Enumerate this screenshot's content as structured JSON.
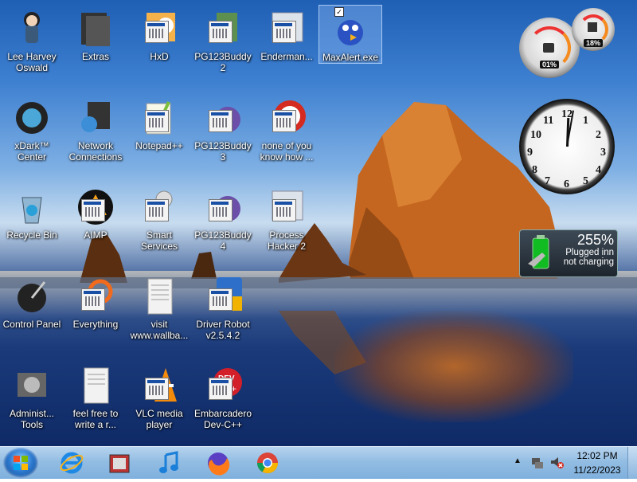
{
  "desktop": {
    "icons": [
      {
        "label": "Lee Harvey Oswald"
      },
      {
        "label": "Extras"
      },
      {
        "label": "HxD"
      },
      {
        "label": "PG123Buddy2"
      },
      {
        "label": "Enderman..."
      },
      {
        "label": "MaxAlert.exe"
      },
      {
        "label": "xDark™ Center"
      },
      {
        "label": "Network Connections"
      },
      {
        "label": "Notepad++"
      },
      {
        "label": "PG123Buddy3"
      },
      {
        "label": "none of you know how ..."
      },
      {
        "label": "Recycle Bin"
      },
      {
        "label": "AIMP"
      },
      {
        "label": "Smart Services"
      },
      {
        "label": "PG123Buddy4"
      },
      {
        "label": "Process Hacker 2"
      },
      {
        "label": "Control Panel"
      },
      {
        "label": "Everything"
      },
      {
        "label": "visit www.wallba..."
      },
      {
        "label": "Driver Robot v2.5.4.2"
      },
      {
        "label": "Administ... Tools"
      },
      {
        "label": "feel free to write a r..."
      },
      {
        "label": "VLC media player"
      },
      {
        "label": "Embarcadero Dev-C++"
      }
    ]
  },
  "gadgets": {
    "cpu_meter": {
      "cpu_percent": "01%",
      "memory_percent": "18%"
    },
    "clock": {
      "numbers": [
        "12",
        "1",
        "2",
        "3",
        "4",
        "5",
        "6",
        "7",
        "8",
        "9",
        "10",
        "11"
      ]
    },
    "battery": {
      "percent": "255%",
      "status_line1": "Plugged inn",
      "status_line2": "not charging"
    }
  },
  "taskbar": {
    "pinned": [
      "start-button",
      "internet-explorer",
      "app-launcher",
      "itunes",
      "firefox",
      "chrome"
    ],
    "clock_time": "12:02 PM",
    "clock_date": "11/22/2023"
  },
  "colors": {
    "sky_top": "#1f5fb4",
    "rock": "#c4661f",
    "taskbar": "#93bde3"
  }
}
